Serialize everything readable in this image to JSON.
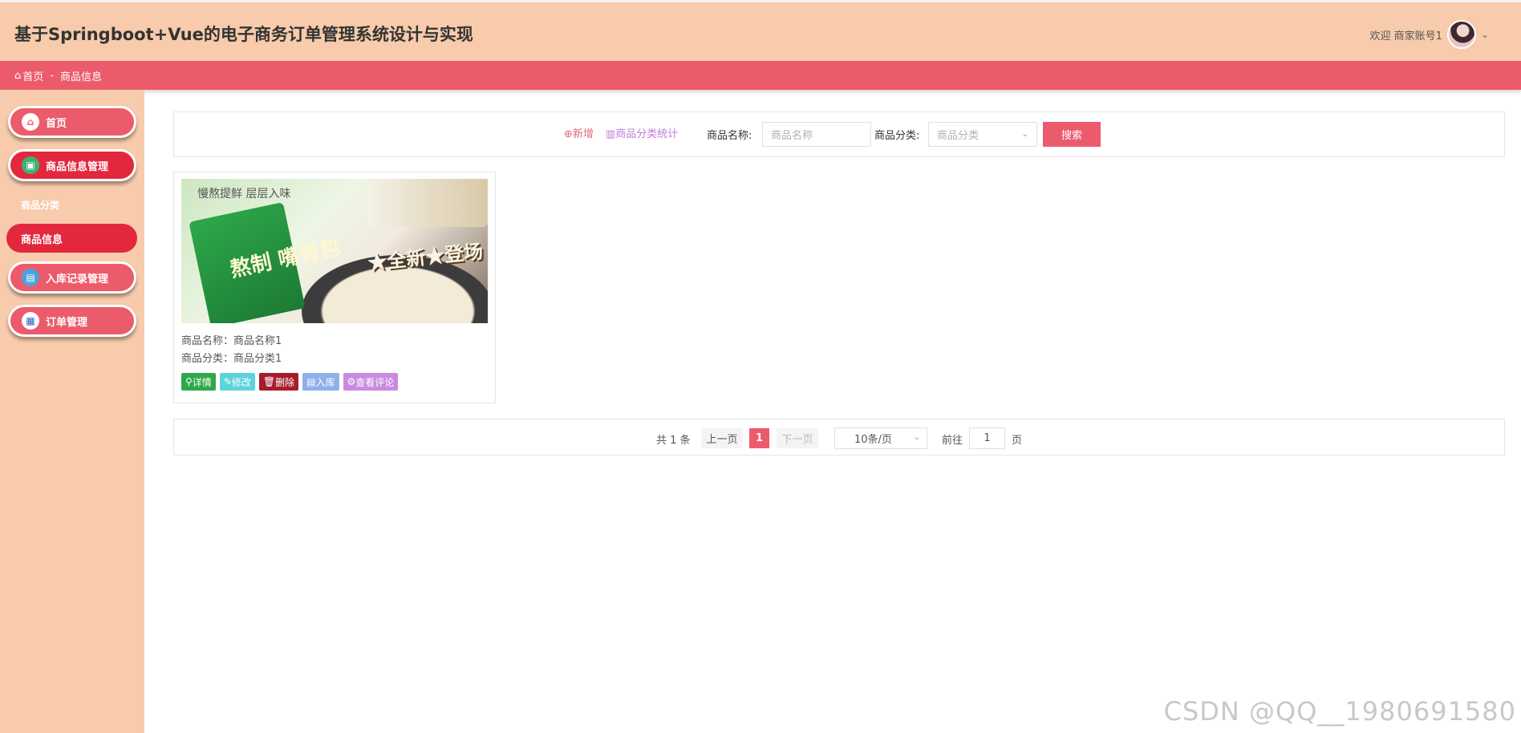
{
  "header": {
    "title": "基于Springboot+Vue的电子商务订单管理系统设计与实现",
    "welcome": "欢迎 商家账号1"
  },
  "breadcrumb": {
    "home": "首页",
    "separator": "-",
    "current": "商品信息"
  },
  "sidebar": {
    "items": [
      {
        "label": "首页",
        "icon": "home-icon"
      },
      {
        "label": "商品信息管理",
        "icon": "product-icon"
      },
      {
        "label": "商品分类",
        "icon": ""
      },
      {
        "label": "商品信息",
        "icon": ""
      },
      {
        "label": "入库记录管理",
        "icon": "storage-icon"
      },
      {
        "label": "订单管理",
        "icon": "order-icon"
      }
    ]
  },
  "search": {
    "add_label": "新增",
    "stats_label": "商品分类统计",
    "name_label": "商品名称:",
    "name_placeholder": "商品名称",
    "category_label": "商品分类:",
    "category_placeholder": "商品分类",
    "button_label": "搜索"
  },
  "product": {
    "image_slogan": "慢熬提鲜 层层入味",
    "image_banner": "★全新★登场",
    "image_pack_text": "熬制 嘴骨包",
    "name_line": "商品名称：商品名称1",
    "category_line": "商品分类：商品分类1",
    "actions": {
      "detail": "详情",
      "edit": "修改",
      "delete": "删除",
      "stock": "入库",
      "review": "查看评论"
    }
  },
  "pagination": {
    "total": "共 1 条",
    "prev": "上一页",
    "current_page": "1",
    "next": "下一页",
    "page_size": "10条/页",
    "goto_label": "前往",
    "goto_value": "1",
    "page_unit": "页"
  },
  "watermark": "CSDN @QQ__1980691580",
  "colors": {
    "header_bg": "#f7cbab",
    "accent": "#ec5b6b",
    "active": "#e3283e"
  }
}
